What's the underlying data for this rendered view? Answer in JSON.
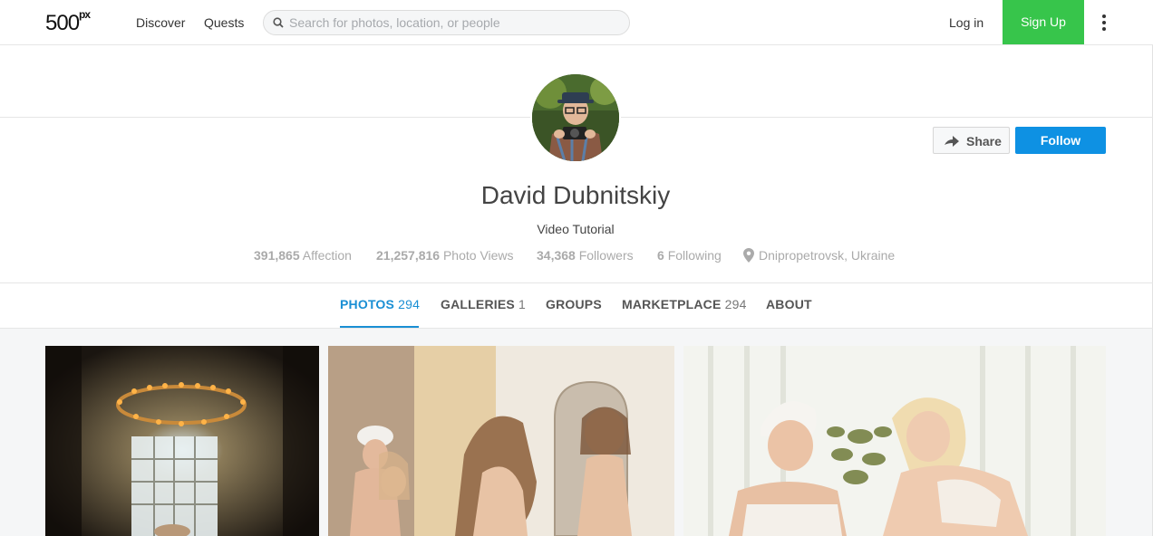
{
  "nav": {
    "logo": "500",
    "logo_sup": "px",
    "discover": "Discover",
    "quests": "Quests",
    "search_placeholder": "Search for photos, location, or people",
    "login": "Log in",
    "signup": "Sign Up"
  },
  "profile": {
    "name": "David Dubnitskiy",
    "subtitle": "Video Tutorial",
    "share_label": "Share",
    "follow_label": "Follow",
    "stats": {
      "affection_value": "391,865",
      "affection_label": "Affection",
      "views_value": "21,257,816",
      "views_label": "Photo Views",
      "followers_value": "34,368",
      "followers_label": "Followers",
      "following_value": "6",
      "following_label": "Following",
      "location": "Dnipropetrovsk, Ukraine"
    }
  },
  "tabs": [
    {
      "label": "PHOTOS",
      "count": "294"
    },
    {
      "label": "GALLERIES",
      "count": "1"
    },
    {
      "label": "GROUPS",
      "count": ""
    },
    {
      "label": "MARKETPLACE",
      "count": "294"
    },
    {
      "label": "ABOUT",
      "count": ""
    }
  ],
  "colors": {
    "accent": "#0e91e3",
    "signup": "#37c54b",
    "tab_active": "#1a8fd4"
  },
  "icons": [
    "search-icon",
    "share-arrow-icon",
    "location-pin-icon",
    "more-vertical-icon"
  ]
}
